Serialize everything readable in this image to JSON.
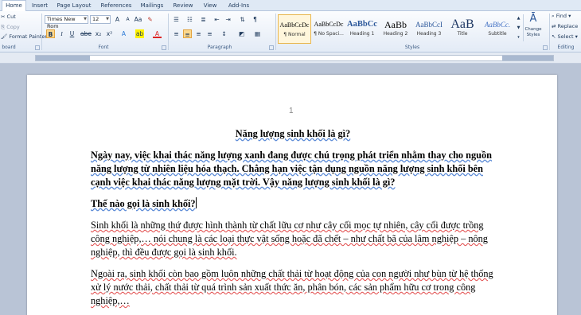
{
  "tabs": [
    "Home",
    "Insert",
    "Page Layout",
    "References",
    "Mailings",
    "Review",
    "View",
    "Add-Ins"
  ],
  "clipboard": {
    "cut": "Cut",
    "copy": "Copy",
    "format_painter": "Format Painter",
    "label": "board"
  },
  "font": {
    "family": "Times New Rom",
    "size": "12",
    "label": "Font"
  },
  "paragraph": {
    "label": "Paragraph"
  },
  "styles": {
    "label": "Styles",
    "items": [
      {
        "sample": "AaBbCcDc",
        "name": "¶ Normal",
        "selected": true
      },
      {
        "sample": "AaBbCcDc",
        "name": "¶ No Spaci...",
        "selected": false
      },
      {
        "sample": "AaBbCc",
        "name": "Heading 1",
        "selected": false
      },
      {
        "sample": "AaBb",
        "name": "Heading 2",
        "selected": false
      },
      {
        "sample": "AaBbCcI",
        "name": "Heading 3",
        "selected": false
      },
      {
        "sample": "AaB",
        "name": "Title",
        "selected": false
      },
      {
        "sample": "AaBbCc.",
        "name": "Subtitle",
        "selected": false
      }
    ],
    "change_styles": "Change Styles"
  },
  "editing": {
    "find": "Find",
    "replace": "Replace",
    "select": "Select",
    "label": "Editing"
  },
  "document": {
    "page_number": "1",
    "title": "Năng lượng sinh khối là gì?",
    "intro": "Ngày nay, việc khai thác năng lượng xanh đang được chú trọng phát triển nhằm thay cho nguồn năng lượng từ nhiên liệu hóa thạch. Chẳng hạn việc tận dụng nguồn năng lượng sinh khối bên cạnh việc khai thác năng lượng mặt trời. Vậy năng lượng sinh khối là gì?",
    "heading": "Thế nào gọi là sinh khối?",
    "para1": "Sinh khối là những thứ được hình thành từ chất lữu cơ như cây cối mọc tự nhiên, cây cối được trồng công nghiệp,… nói chung là các loại thực vật sống hoặc đã chết – như chất bã của lâm nghiệp – nông nghiệp, thì đều được gọi là sinh khối.",
    "para2": "Ngoài ra, sinh khối còn bao gồm luôn những chất thải từ hoạt động của con người như bùn từ hệ thống xử lý nước thải, chất thải từ quá trình sản xuất thức ăn, phân bón, các sản phẩm hữu cơ trong công nghiệp,…"
  }
}
